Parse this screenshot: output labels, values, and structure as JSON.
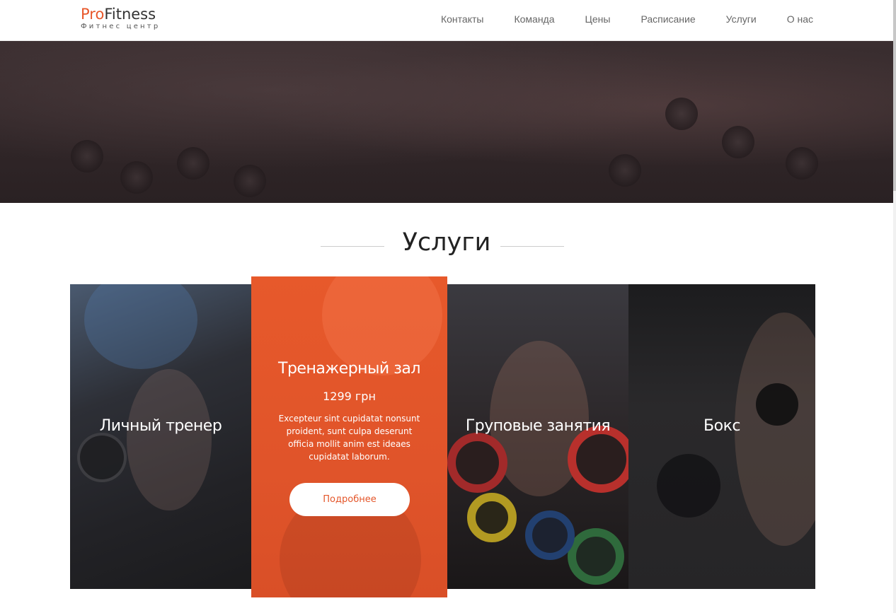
{
  "brand": {
    "pro": "Pro",
    "fitness": "Fitness",
    "subtitle": "Фитнес центр",
    "accent": "#e8572a"
  },
  "nav": {
    "items": [
      "Контакты",
      "Команда",
      "Цены",
      "Расписание",
      "Услуги",
      "О нас"
    ]
  },
  "services": {
    "title": "Услуги",
    "cards": [
      {
        "title": "Личный тренер"
      },
      {
        "title": "Тренажерный зал",
        "price": "1299 грн",
        "text": "Excepteur sint cupidatat nonsunt proident, sunt culpa deserunt officia mollit anim est ideaes cupidatat laborum.",
        "button": "Подробнее"
      },
      {
        "title": "Груповые занятия"
      },
      {
        "title": "Бокс"
      }
    ]
  }
}
